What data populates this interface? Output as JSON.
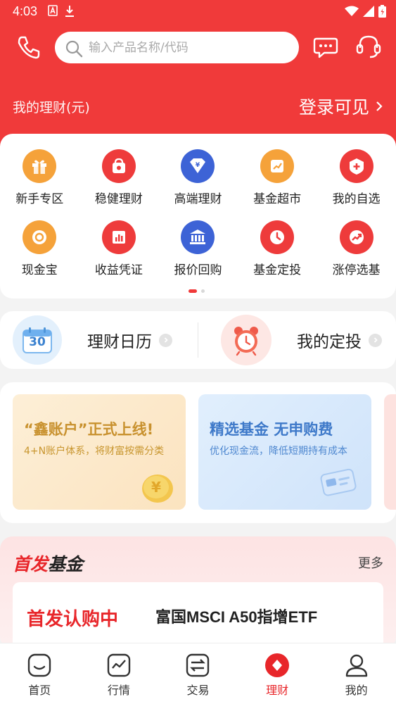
{
  "status_bar": {
    "time": "4:03"
  },
  "search": {
    "placeholder": "输入产品名称/代码"
  },
  "wealth": {
    "label": "我的理财(元)",
    "login_text": "登录可见"
  },
  "quick_entries": [
    {
      "label": "新手专区",
      "icon": "gift-icon",
      "color": "#f5a23a"
    },
    {
      "label": "稳健理财",
      "icon": "wallet-icon",
      "color": "#ee3b3b"
    },
    {
      "label": "高端理财",
      "icon": "diamond-yen-icon",
      "color": "#3d63d6"
    },
    {
      "label": "基金超市",
      "icon": "chart-card-icon",
      "color": "#f5a23a"
    },
    {
      "label": "我的自选",
      "icon": "shield-plus-icon",
      "color": "#ee3b3b"
    },
    {
      "label": "现金宝",
      "icon": "coin-icon",
      "color": "#f5a23a"
    },
    {
      "label": "收益凭证",
      "icon": "bar-chart-icon",
      "color": "#ee3b3b"
    },
    {
      "label": "报价回购",
      "icon": "bank-icon",
      "color": "#3d63d6"
    },
    {
      "label": "基金定投",
      "icon": "clock-icon",
      "color": "#ee3b3b"
    },
    {
      "label": "涨停选基",
      "icon": "trend-icon",
      "color": "#ee3b3b"
    }
  ],
  "plans": [
    {
      "label": "理财日历",
      "icon": "calendar-icon",
      "calendar_day": "30"
    },
    {
      "label": "我的定投",
      "icon": "alarm-clock-icon"
    }
  ],
  "banners": [
    {
      "title": "“鑫账户”正式上线!",
      "subtitle": "4+N账户体系，将财富按需分类"
    },
    {
      "title": "精选基金 无申购费",
      "subtitle": "优化现金流，降低短期持有成本"
    }
  ],
  "ipo": {
    "title_part1": "首发",
    "title_part2": "基金",
    "more": "更多",
    "status": "首发认购中",
    "fund_name": "富国MSCI A50指增ETF"
  },
  "tabs": [
    {
      "label": "首页",
      "icon": "home-icon",
      "active": false
    },
    {
      "label": "行情",
      "icon": "market-icon",
      "active": false
    },
    {
      "label": "交易",
      "icon": "trade-icon",
      "active": false
    },
    {
      "label": "理财",
      "icon": "wealth-icon",
      "active": true
    },
    {
      "label": "我的",
      "icon": "user-icon",
      "active": false
    }
  ],
  "colors": {
    "brand_red": "#f03a3a",
    "accent_blue": "#3d63d6",
    "accent_orange": "#f5a23a"
  }
}
